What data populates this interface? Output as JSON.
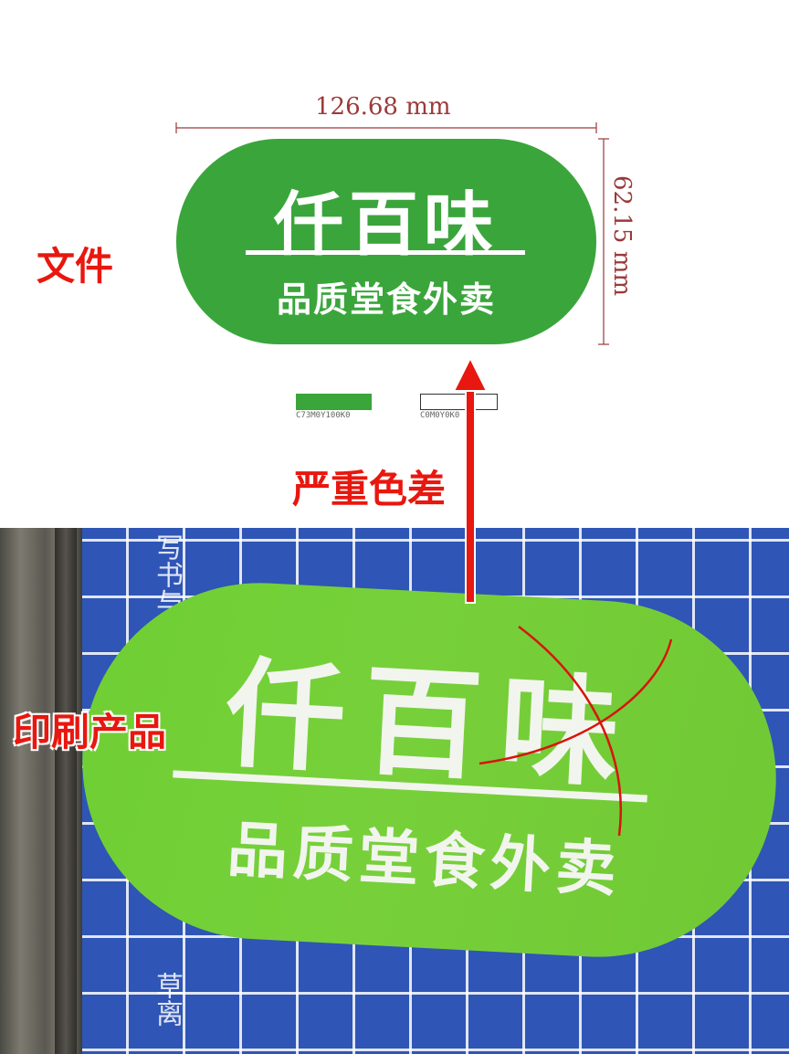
{
  "design_file": {
    "width_dimension": "126.68 mm",
    "height_dimension": "62.15 mm",
    "brand_name": "仟百味",
    "subtitle": "品质堂食外卖",
    "swatch_green_label": "C73M0Y100K0",
    "swatch_white_label": "C0M0Y0K0",
    "green_color": "#3aa53b"
  },
  "printed_product": {
    "brand_name": "仟百味",
    "subtitle": "品质堂食外卖",
    "green_color": "#74cf37",
    "ruler_text_top": "写书与",
    "ruler_text_bottom": "草离"
  },
  "annotations": {
    "file_label": "文件",
    "color_diff_label": "严重色差",
    "product_label": "印刷产品",
    "label_color": "#e8170f"
  }
}
